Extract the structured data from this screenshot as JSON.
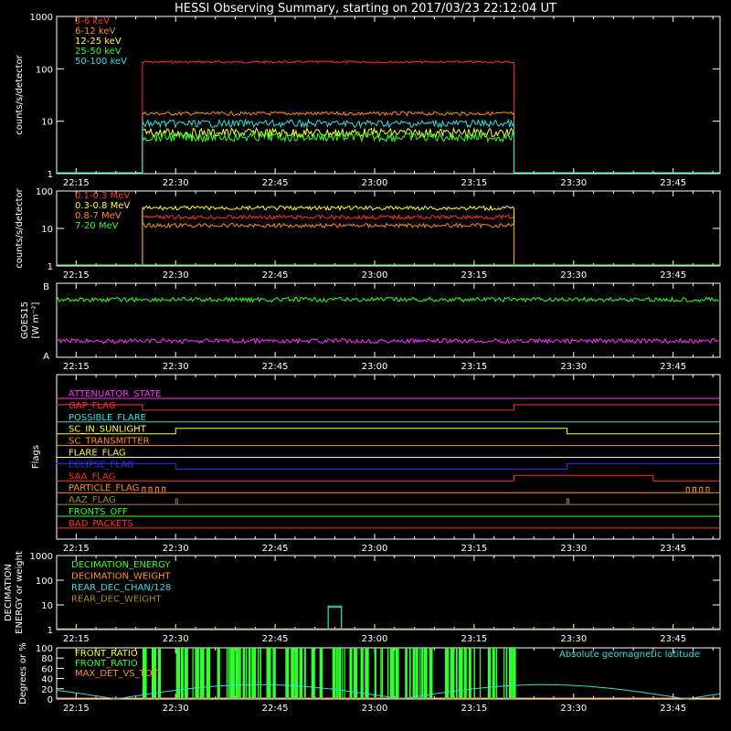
{
  "title": "HESSI Observing Summary, starting on 2017/03/23 22:12:04 UT",
  "time_ticks": [
    "22:15",
    "22:30",
    "22:45",
    "23:00",
    "23:15",
    "23:30",
    "23:45"
  ],
  "colors": {
    "red": "#ff3030",
    "orange": "#ff8c20",
    "yellow": "#ffff30",
    "green": "#30ff30",
    "cyan": "#30e0e0",
    "magenta": "#ff30ff",
    "blue": "#3030ff",
    "olive": "#a08c20",
    "white": "#ffffff"
  },
  "chart_data": [
    {
      "id": "low_energy",
      "type": "line",
      "ylabel": "counts/s/detector",
      "yscale": "log",
      "ylim": [
        1,
        1000
      ],
      "yticks": [
        "1",
        "10",
        "100",
        "1000"
      ],
      "x_range": [
        "22:12:04",
        "23:52:04"
      ],
      "series": [
        {
          "name": "3-6 keV",
          "color": "red",
          "start": "22:25",
          "end": "23:21",
          "level": 135
        },
        {
          "name": "6-12 keV",
          "color": "orange",
          "start": "22:25",
          "end": "23:21",
          "level": 14
        },
        {
          "name": "12-25 keV",
          "color": "yellow",
          "start": "22:25",
          "end": "23:21",
          "level": 6
        },
        {
          "name": "25-50 keV",
          "color": "green",
          "start": "22:25",
          "end": "23:21",
          "level": 5
        },
        {
          "name": "50-100 keV",
          "color": "cyan",
          "start": "22:25",
          "end": "23:21",
          "level": 9
        }
      ]
    },
    {
      "id": "high_energy",
      "type": "line",
      "ylabel": "counts/s/detector",
      "yscale": "log",
      "ylim": [
        1,
        100
      ],
      "yticks": [
        "1",
        "10",
        "100"
      ],
      "series": [
        {
          "name": "0.1-0.3 MeV",
          "color": "red",
          "start": "22:25",
          "end": "23:21",
          "level": 20
        },
        {
          "name": "0.3-0.8 MeV",
          "color": "yellow",
          "start": "22:25",
          "end": "23:21",
          "level": 35
        },
        {
          "name": "0.8-7 MeV",
          "color": "orange",
          "start": "22:25",
          "end": "23:21",
          "level": 12
        },
        {
          "name": "7-20 MeV",
          "color": "green",
          "start": "22:25",
          "end": "23:21",
          "level": 1
        }
      ]
    },
    {
      "id": "goes",
      "type": "line",
      "ylabel": "GOES15",
      "yunit": "[W m⁻²]",
      "yticks": [
        "A",
        "B"
      ],
      "series": [
        {
          "color": "green",
          "level_fraction": 0.78
        },
        {
          "color": "magenta",
          "level_fraction": 0.22
        }
      ]
    },
    {
      "id": "flags",
      "type": "line",
      "ylabel": "Flags",
      "series": [
        {
          "name": "ATTENUATOR_STATE",
          "color": "magenta",
          "steps": []
        },
        {
          "name": "GAP_FLAG",
          "color": "red",
          "steps": [
            [
              "22:12",
              "22:25",
              1
            ],
            [
              "22:25",
              "23:21",
              0
            ],
            [
              "23:21",
              "23:52",
              1
            ]
          ]
        },
        {
          "name": "POSSIBLE_FLARE",
          "color": "cyan",
          "steps": []
        },
        {
          "name": "SC_IN_SUNLIGHT",
          "color": "yellow",
          "steps": [
            [
              "22:12",
              "22:30",
              0
            ],
            [
              "22:30",
              "23:29",
              1
            ],
            [
              "23:29",
              "23:52",
              0
            ]
          ]
        },
        {
          "name": "SC_TRANSMITTER",
          "color": "orange",
          "steps": []
        },
        {
          "name": "FLARE_FLAG",
          "color": "yellow",
          "steps": []
        },
        {
          "name": "ECLIPSE_FLAG",
          "color": "blue",
          "steps": [
            [
              "22:12",
              "22:30",
              1
            ],
            [
              "22:30",
              "23:29",
              0
            ],
            [
              "23:29",
              "23:52",
              1
            ]
          ]
        },
        {
          "name": "SAA_FLAG",
          "color": "red",
          "steps": [
            [
              "22:12",
              "23:21",
              0
            ],
            [
              "23:21",
              "23:42",
              1
            ],
            [
              "23:42",
              "23:52",
              0
            ]
          ]
        },
        {
          "name": "PARTICLE_FLAG",
          "color": "orange",
          "steps": []
        },
        {
          "name": "AAZ_FLAG",
          "color": "olive",
          "steps": []
        },
        {
          "name": "FRONTS_OFF",
          "color": "green",
          "steps": []
        },
        {
          "name": "BAD_PACKETS",
          "color": "red",
          "steps": []
        }
      ]
    },
    {
      "id": "decimation",
      "type": "line",
      "ylabel": "DECIMATION",
      "ylabel2": "ENERGY or weight",
      "yscale": "log",
      "yticks": [
        "1",
        "10",
        "100",
        "1000"
      ],
      "series": [
        {
          "name": "DECIMATION_ENERGY",
          "color": "green",
          "pulse": [
            "22:53",
            "22:55",
            8
          ]
        },
        {
          "name": "DECIMATION_WEIGHT",
          "color": "orange"
        },
        {
          "name": "REAR_DEC_CHAN/128",
          "color": "cyan",
          "pulse": [
            "22:53",
            "22:55",
            9
          ]
        },
        {
          "name": "REAR_DEC_WEIGHT",
          "color": "olive"
        }
      ]
    },
    {
      "id": "ratio",
      "type": "line",
      "ylabel": "Degrees or %",
      "ylim": [
        0,
        100
      ],
      "yticks": [
        "0",
        "20",
        "40",
        "60",
        "80",
        "100"
      ],
      "legend_right": "Absolute geomagnetic latitude",
      "series": [
        {
          "name": "FRONT_RATIO",
          "color": "yellow"
        },
        {
          "name": "FRONT_RATIO",
          "color": "green",
          "start": "22:25",
          "end": "23:21",
          "level": 100
        },
        {
          "name": "MAX_DET_VS_TOT",
          "color": "orange"
        },
        {
          "name": "Absolute geomagnetic latitude",
          "color": "cyan",
          "min": 0,
          "max": 28
        }
      ]
    }
  ]
}
